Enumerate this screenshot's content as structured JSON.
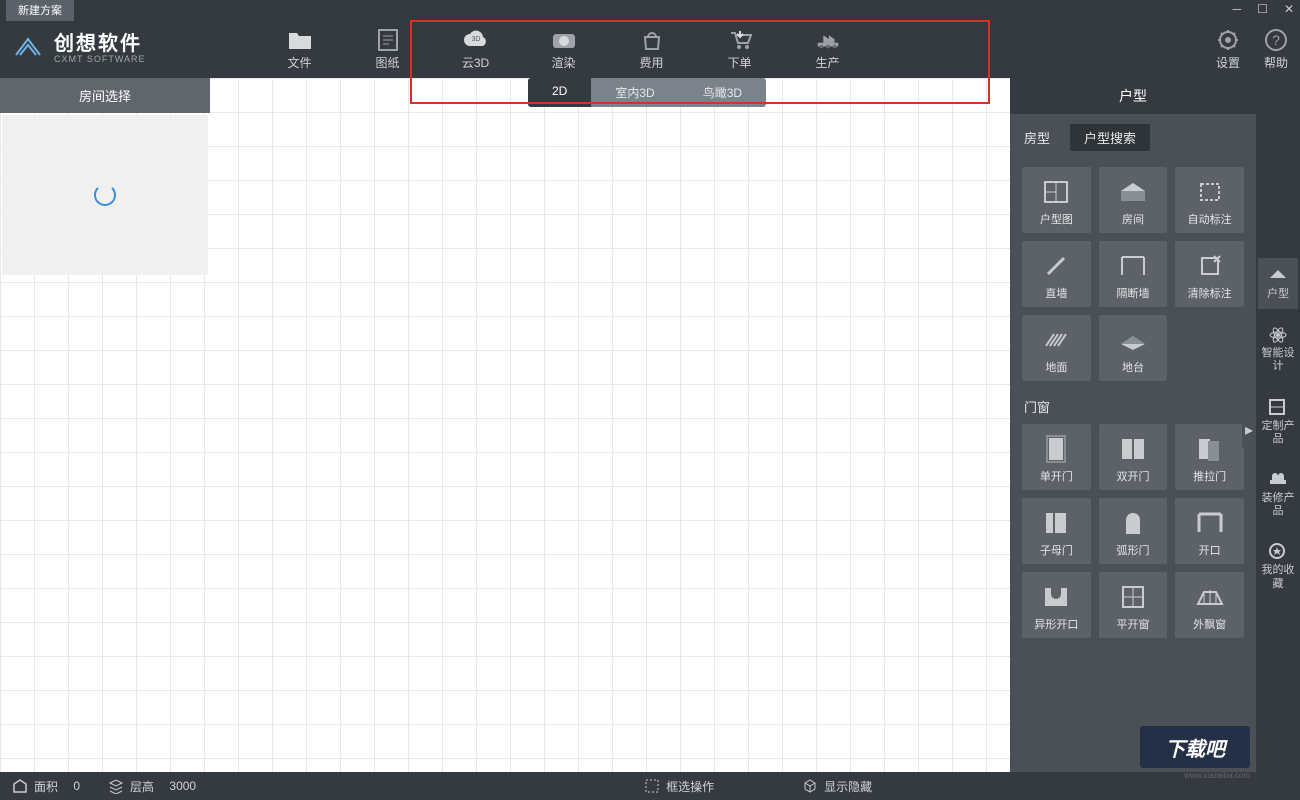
{
  "titlebar": {
    "tab": "新建方案"
  },
  "logo": {
    "main": "创想软件",
    "sub": "CXMT SOFTWARE"
  },
  "toolbar": {
    "file": "文件",
    "drawing": "图纸",
    "cloud3d": "云3D",
    "render": "渲染",
    "cost": "费用",
    "order": "下单",
    "produce": "生产",
    "settings": "设置",
    "help": "帮助"
  },
  "viewtabs": {
    "v2d": "2D",
    "indoor3d": "室内3D",
    "bird3d": "鸟瞰3D"
  },
  "left": {
    "title": "房间选择"
  },
  "right": {
    "title": "户型",
    "tab_type": "房型",
    "tab_search": "户型搜索",
    "section_doors": "门窗",
    "tools": {
      "floorplan": "户型图",
      "room": "房间",
      "auto_dim": "自动标注",
      "wall": "直墙",
      "partition": "隔断墙",
      "clear_dim": "清除标注",
      "floor": "地面",
      "platform": "地台",
      "single_door": "单开门",
      "double_door": "双开门",
      "sliding_door": "推拉门",
      "mother_door": "子母门",
      "arc_door": "弧形门",
      "opening": "开口",
      "shaped_opening": "异形开口",
      "casement_window": "平开窗",
      "bay_window": "外飘窗"
    }
  },
  "sidebar": {
    "layout": "户型",
    "smart": "智能设计",
    "custom": "定制产品",
    "deco": "装修产品",
    "fav": "我的收藏"
  },
  "status": {
    "area_label": "面积",
    "area_val": "0",
    "height_label": "层高",
    "height_val": "3000",
    "box_select": "框选操作",
    "show_hide": "显示隐藏"
  },
  "watermark": {
    "main": "下载吧",
    "sub": "www.xiazaiba.com"
  }
}
